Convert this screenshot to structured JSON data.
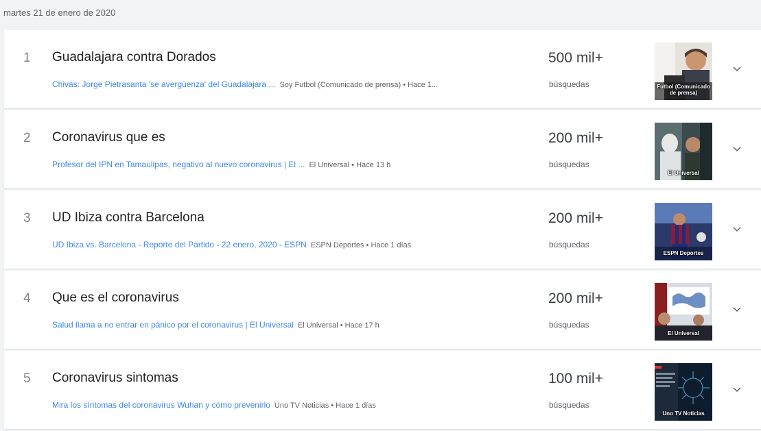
{
  "date_header": "martes 21 de enero de 2020",
  "trends": [
    {
      "rank": "1",
      "title": "Guadalajara contra Dorados",
      "article": "Chivas: Jorge Pietrasanta 'se avergüenza' del Guadalajara ...",
      "source": "Soy Futbol (Comunicado de prensa) • Hace 1...",
      "count": "500 mil+",
      "count_label": "búsquedas",
      "thumb_caption": "Futbol (Comunicado de prensa)"
    },
    {
      "rank": "2",
      "title": "Coronavirus que es",
      "article": "Profesor del IPN en Tamaulipas, negativo al nuevo coronavirus | El ...",
      "source": "El Universal • Hace 13 h",
      "count": "200 mil+",
      "count_label": "búsquedas",
      "thumb_caption": "El Universal"
    },
    {
      "rank": "3",
      "title": "UD Ibiza contra Barcelona",
      "article": "UD Ibiza vs. Barcelona - Reporte del Partido - 22 enero, 2020 - ESPN",
      "source": "ESPN Deportes • Hace 1 días",
      "count": "200 mil+",
      "count_label": "búsquedas",
      "thumb_caption": "ESPN Deportes"
    },
    {
      "rank": "4",
      "title": "Que es el coronavirus",
      "article": "Salud llama a no entrar en pánico por el coronavirus | El Universal",
      "source": "El Universal • Hace 17 h",
      "count": "200 mil+",
      "count_label": "búsquedas",
      "thumb_caption": "El Universal"
    },
    {
      "rank": "5",
      "title": "Coronavirus sintomas",
      "article": "Mira los síntomas del coronavirus Wuhan y cómo prevenirlo",
      "source": "Uno TV Noticias • Hace 1 días",
      "count": "100 mil+",
      "count_label": "búsquedas",
      "thumb_caption": "Uno TV Noticias"
    }
  ],
  "icons": {
    "expand": "chevron-down-icon"
  },
  "colors": {
    "link": "#1a73e8",
    "title": "#202124",
    "muted": "#5f6368",
    "background": "#f1f3f4"
  }
}
